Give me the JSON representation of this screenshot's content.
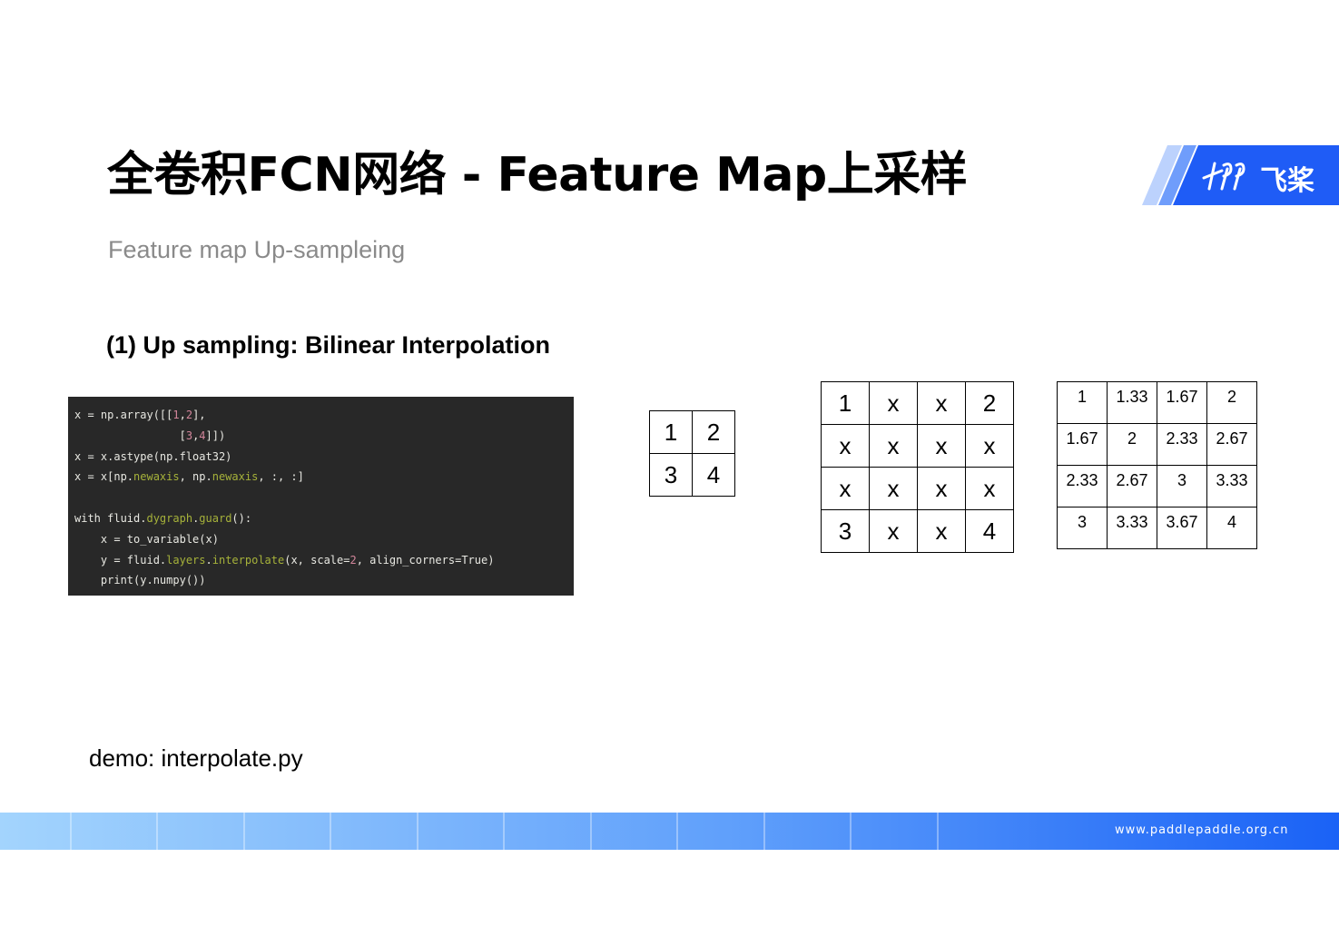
{
  "slide": {
    "title": "全卷积FCN网络 - Feature Map上采样",
    "subtitle": "Feature map Up-sampleing",
    "section_heading": "(1) Up sampling: Bilinear Interpolation",
    "demo_text": "demo: interpolate.py",
    "footer_url": "www.paddlepaddle.org.cn"
  },
  "logo": {
    "text": "飞桨",
    "icon": "paddle-logo-icon",
    "colors": {
      "dark": "#1f5cf6",
      "mid": "#6f9dfb",
      "light": "#bcd2fd"
    }
  },
  "code": {
    "lines": [
      [
        {
          "t": "x = np.array([[",
          "c": ""
        },
        {
          "t": "1",
          "c": "num"
        },
        {
          "t": ",",
          "c": ""
        },
        {
          "t": "2",
          "c": "num"
        },
        {
          "t": "],",
          "c": ""
        }
      ],
      [
        {
          "t": "                [",
          "c": ""
        },
        {
          "t": "3",
          "c": "num"
        },
        {
          "t": ",",
          "c": ""
        },
        {
          "t": "4",
          "c": "num"
        },
        {
          "t": "]])",
          "c": ""
        }
      ],
      [
        {
          "t": "x = x.astype(np.float32)",
          "c": ""
        }
      ],
      [
        {
          "t": "x = x[np.",
          "c": ""
        },
        {
          "t": "newaxis",
          "c": "attr"
        },
        {
          "t": ", np.",
          "c": ""
        },
        {
          "t": "newaxis",
          "c": "attr"
        },
        {
          "t": ", :, :]",
          "c": ""
        }
      ],
      [
        {
          "t": "",
          "c": ""
        }
      ],
      [
        {
          "t": "with fluid.",
          "c": ""
        },
        {
          "t": "dygraph",
          "c": "attr"
        },
        {
          "t": ".",
          "c": ""
        },
        {
          "t": "guard",
          "c": "attr"
        },
        {
          "t": "():",
          "c": ""
        }
      ],
      [
        {
          "t": "    x = to_variable(x)",
          "c": ""
        }
      ],
      [
        {
          "t": "    y = fluid.",
          "c": ""
        },
        {
          "t": "layers",
          "c": "attr"
        },
        {
          "t": ".",
          "c": ""
        },
        {
          "t": "interpolate",
          "c": "attr"
        },
        {
          "t": "(x, scale=",
          "c": ""
        },
        {
          "t": "2",
          "c": "num"
        },
        {
          "t": ", align_corners=True)",
          "c": ""
        }
      ],
      [
        {
          "t": "    print(y.numpy())",
          "c": ""
        }
      ]
    ],
    "colors": {
      "background": "#282828",
      "text": "#e8e8e2",
      "number": "#d3869b",
      "attribute": "#a6b23a"
    }
  },
  "input_grid": [
    [
      "1",
      "2"
    ],
    [
      "3",
      "4"
    ]
  ],
  "placeholder_grid": [
    [
      "1",
      "x",
      "x",
      "2"
    ],
    [
      "x",
      "x",
      "x",
      "x"
    ],
    [
      "x",
      "x",
      "x",
      "x"
    ],
    [
      "3",
      "x",
      "x",
      "4"
    ]
  ],
  "output_grid": [
    [
      "1",
      "1.33",
      "1.67",
      "2"
    ],
    [
      "1.67",
      "2",
      "2.33",
      "2.67"
    ],
    [
      "2.33",
      "2.67",
      "3",
      "3.33"
    ],
    [
      "3",
      "3.33",
      "3.67",
      "4"
    ]
  ],
  "footer_colors": {
    "start": "#a3d4fd",
    "end": "#1a62f6"
  }
}
